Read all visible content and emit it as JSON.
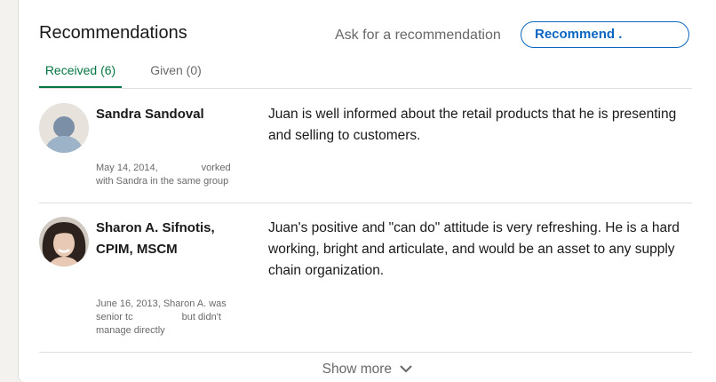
{
  "section": {
    "title": "Recommendations",
    "ask_link": "Ask for a recommendation",
    "recommend_button": "Recommend ."
  },
  "tabs": [
    {
      "label": "Received (6)",
      "active": true
    },
    {
      "label": "Given (0)",
      "active": false
    }
  ],
  "recommendations": [
    {
      "name_line1": "Sandra Sandoval",
      "name_line2": "",
      "meta_line1": "May 14, 2014,                vorked",
      "meta_line2": "with Sandra in the same group",
      "meta_line3": "",
      "text": "Juan is well informed about the retail products that he is presenting and selling to customers.",
      "avatar": "default-person-avatar"
    },
    {
      "name_line1": "Sharon A. Sifnotis,",
      "name_line2": "CPIM, MSCM",
      "meta_line1": "June 16, 2013, Sharon A. was",
      "meta_line2": "senior tc                  but didn't",
      "meta_line3": "manage directly",
      "text": "Juan's positive and \"can do\" attitude is very refreshing. He is a hard working, bright and articulate, and would be an asset to any supply chain organization.",
      "avatar": "profile-photo"
    }
  ],
  "footer": {
    "show_more": "Show more",
    "icon": "chevron-down-icon"
  },
  "colors": {
    "accent": "#0a66c2",
    "active_tab": "#057642",
    "background": "#f3f2ef"
  }
}
